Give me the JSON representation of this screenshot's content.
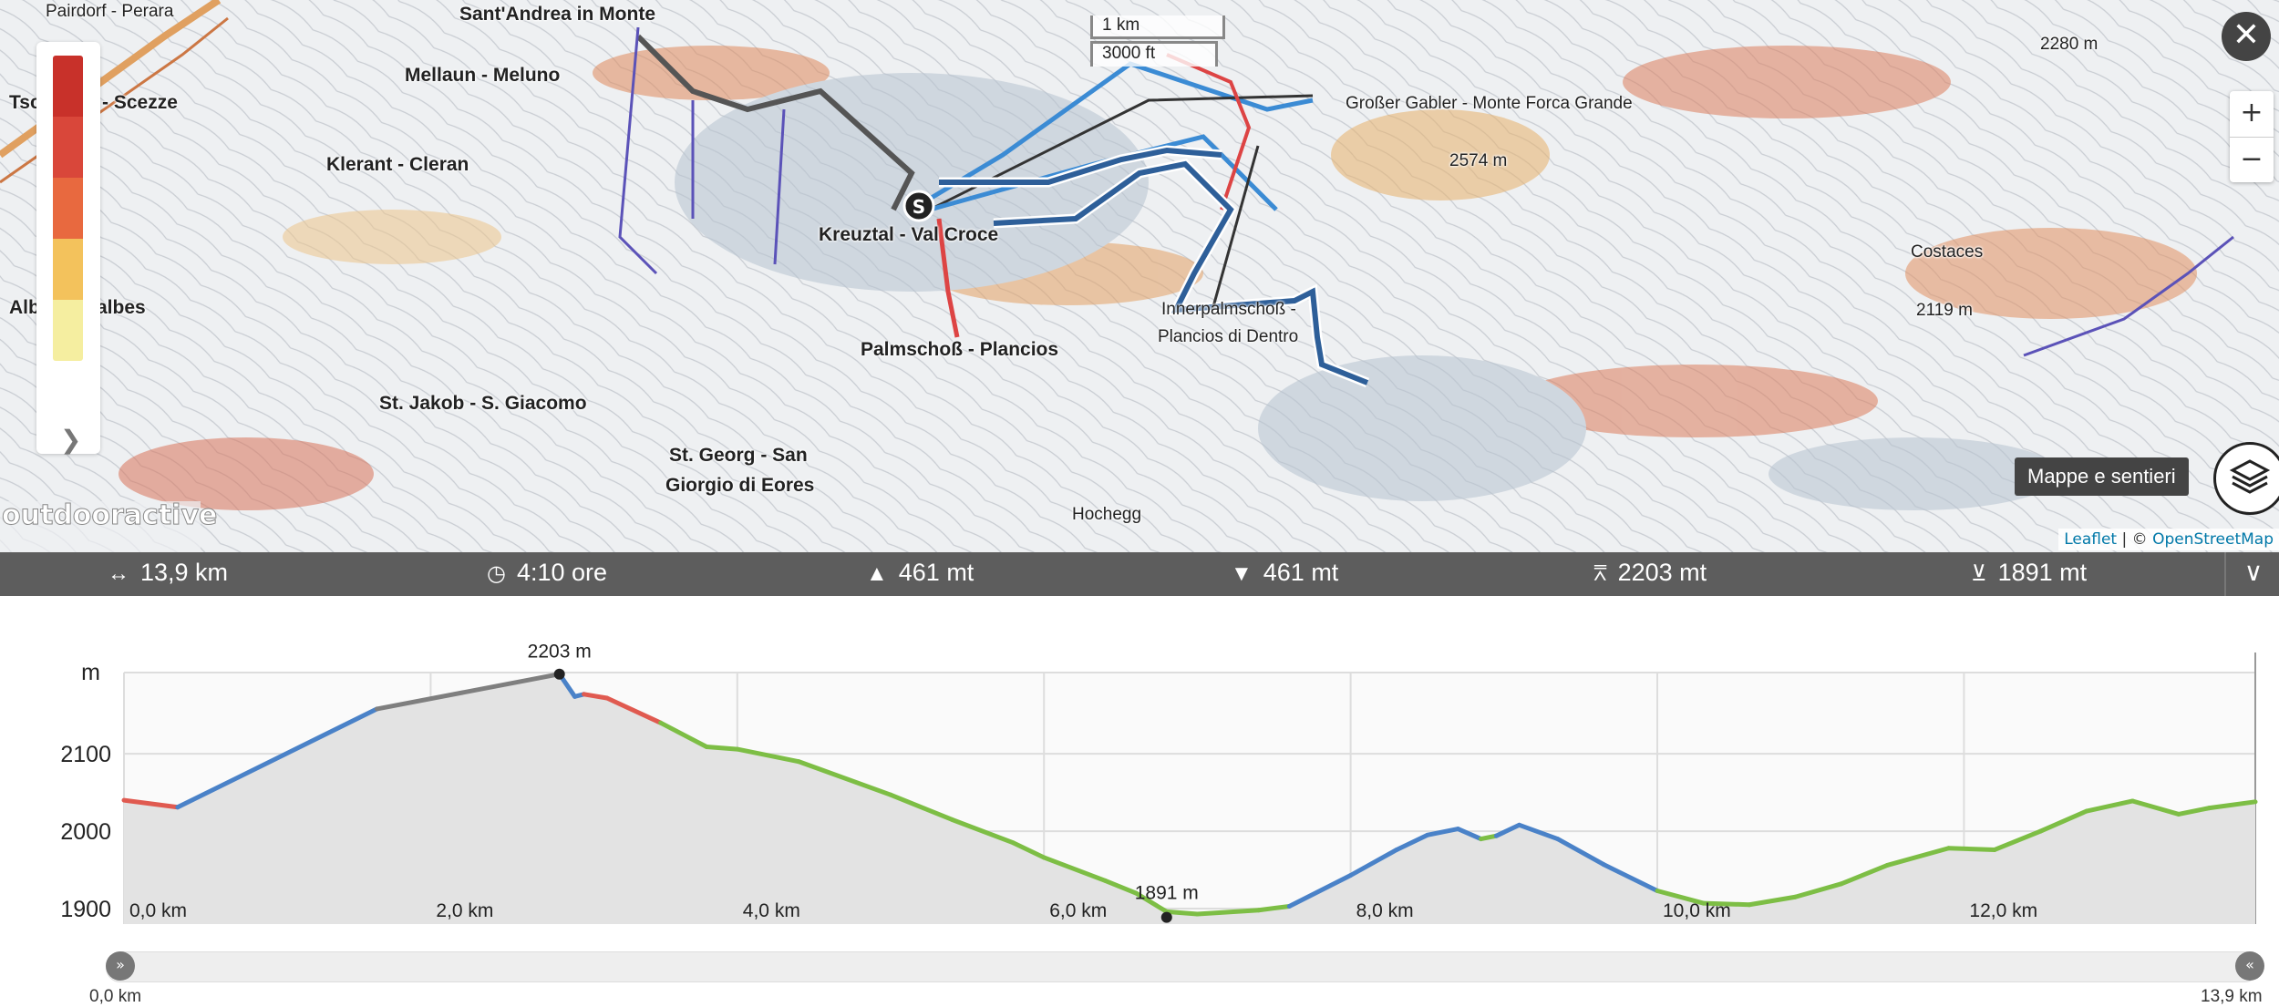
{
  "map": {
    "places": [
      {
        "name": "Pairdorf - Perara",
        "cls": "small"
      },
      {
        "name": "Sant'Andrea in Monte",
        "cls": ""
      },
      {
        "name": "Mellaun - Meluno",
        "cls": ""
      },
      {
        "name": "Tsc",
        "cls": ""
      },
      {
        "name": "- Scezze",
        "cls": ""
      },
      {
        "name": "Klerant - Cleran",
        "cls": ""
      },
      {
        "name": "Kreuztal - Val Croce",
        "cls": ""
      },
      {
        "name": "Palmschoß - Plancios",
        "cls": ""
      },
      {
        "name": "Alb",
        "cls": ""
      },
      {
        "name": "albes",
        "cls": ""
      },
      {
        "name": "St. Jakob - S. Giacomo",
        "cls": ""
      },
      {
        "name": "St. Georg - San",
        "cls": ""
      },
      {
        "name": "Giorgio di Eores",
        "cls": ""
      },
      {
        "name": "Hochegg",
        "cls": "small"
      },
      {
        "name": "Großer Gabler - Monte Forca Grande",
        "cls": "small"
      },
      {
        "name": "2574 m",
        "cls": "small"
      },
      {
        "name": "Innerpalmschoß -",
        "cls": "small"
      },
      {
        "name": "Plancios di Dentro",
        "cls": "small"
      },
      {
        "name": "Costaces",
        "cls": "small"
      },
      {
        "name": "2119 m",
        "cls": "small"
      },
      {
        "name": "2280 m",
        "cls": "small"
      }
    ],
    "scale": {
      "metric": "1 km",
      "imperial": "3000 ft"
    },
    "watermark": "outdooractive",
    "layers_tooltip": "Mappe e sentieri",
    "attribution": {
      "leaflet": "Leaflet",
      "sep": " | © ",
      "osm": "OpenStreetMap"
    },
    "legend_colors": [
      "#c8312a",
      "#d9473a",
      "#e8693f",
      "#f3c25c",
      "#f5eea0"
    ],
    "start_marker": "S",
    "icons": {
      "close": "close-icon",
      "zoom_in": "plus-icon",
      "zoom_out": "minus-icon",
      "layers": "layers-icon",
      "legend_expand": "chevron-right-icon"
    }
  },
  "stats": {
    "distance": "13,9 km",
    "duration": "4:10 ore",
    "ascent": "461 mt",
    "descent": "461 mt",
    "highest": "2203 mt",
    "lowest": "1891 mt",
    "icons": [
      "distance-icon",
      "clock-icon",
      "ascent-icon",
      "descent-icon",
      "highest-point-icon",
      "lowest-point-icon",
      "chevron-down-icon"
    ]
  },
  "chart_data": {
    "type": "area",
    "ylabel": "m",
    "xlim": [
      0,
      13.9
    ],
    "ylim": [
      1880,
      2205
    ],
    "y_ticks": [
      1900,
      2000,
      2100
    ],
    "x_ticks": [
      0,
      2,
      4,
      6,
      8,
      10,
      12
    ],
    "x_tick_labels": [
      "0,0 km",
      "2,0 km",
      "4,0 km",
      "6,0 km",
      "8,0 km",
      "10,0 km",
      "12,0 km"
    ],
    "max_label": "2203 m",
    "min_label": "1891 m",
    "max_point": {
      "x": 2.84,
      "y": 2203
    },
    "min_point": {
      "x": 6.8,
      "y": 1891
    },
    "series_colors": {
      "blue": "#4a82c8",
      "red": "#e05a50",
      "gray": "#7f7f7f",
      "green": "#7dbe45"
    },
    "points": [
      [
        0.0,
        2040,
        "red"
      ],
      [
        0.35,
        2031,
        "blue"
      ],
      [
        1.65,
        2158,
        "gray"
      ],
      [
        2.84,
        2203,
        "blue"
      ],
      [
        2.94,
        2174,
        "blue"
      ],
      [
        3.0,
        2177,
        "red"
      ],
      [
        3.15,
        2172,
        "red"
      ],
      [
        3.5,
        2140,
        "green"
      ],
      [
        3.8,
        2109,
        "green"
      ],
      [
        4.0,
        2106,
        "green"
      ],
      [
        4.4,
        2090,
        "green"
      ],
      [
        5.0,
        2047,
        "green"
      ],
      [
        5.4,
        2015,
        "green"
      ],
      [
        5.8,
        1985,
        "green"
      ],
      [
        6.0,
        1966,
        "green"
      ],
      [
        6.4,
        1936,
        "green"
      ],
      [
        6.6,
        1920,
        "green"
      ],
      [
        6.8,
        1896,
        "green"
      ],
      [
        7.0,
        1893,
        "green"
      ],
      [
        7.4,
        1898,
        "green"
      ],
      [
        7.6,
        1903,
        "blue"
      ],
      [
        8.0,
        1943,
        "blue"
      ],
      [
        8.3,
        1976,
        "blue"
      ],
      [
        8.5,
        1995,
        "blue"
      ],
      [
        8.7,
        2003,
        "blue"
      ],
      [
        8.85,
        1990,
        "green"
      ],
      [
        8.95,
        1994,
        "blue"
      ],
      [
        9.1,
        2008,
        "blue"
      ],
      [
        9.35,
        1990,
        "blue"
      ],
      [
        9.65,
        1957,
        "blue"
      ],
      [
        10.0,
        1923,
        "green"
      ],
      [
        10.3,
        1907,
        "green"
      ],
      [
        10.6,
        1905,
        "green"
      ],
      [
        10.9,
        1915,
        "green"
      ],
      [
        11.2,
        1932,
        "green"
      ],
      [
        11.5,
        1956,
        "green"
      ],
      [
        11.9,
        1978,
        "green"
      ],
      [
        12.2,
        1976,
        "green"
      ],
      [
        12.5,
        2000,
        "green"
      ],
      [
        12.8,
        2026,
        "green"
      ],
      [
        13.1,
        2039,
        "green"
      ],
      [
        13.4,
        2022,
        "green"
      ],
      [
        13.6,
        2030,
        "green"
      ],
      [
        13.9,
        2038,
        "green"
      ]
    ]
  },
  "range": {
    "start_label": "0,0 km",
    "end_label": "13,9 km"
  }
}
